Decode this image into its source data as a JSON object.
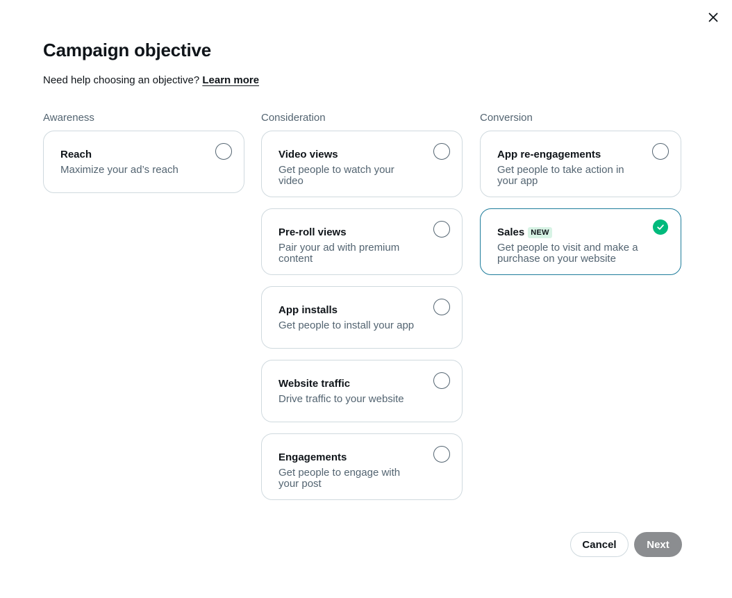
{
  "dialog": {
    "title": "Campaign objective",
    "help_text": "Need help choosing an objective?",
    "help_link": "Learn more",
    "close_icon": "close-icon"
  },
  "columns": [
    {
      "heading": "Awareness",
      "options": [
        {
          "title": "Reach",
          "description": "Maximize your ad’s reach",
          "selected": false
        }
      ]
    },
    {
      "heading": "Consideration",
      "options": [
        {
          "title": "Video views",
          "description": "Get people to watch your video",
          "selected": false
        },
        {
          "title": "Pre-roll views",
          "description": "Pair your ad with premium content",
          "selected": false
        },
        {
          "title": "App installs",
          "description": "Get people to install your app",
          "selected": false
        },
        {
          "title": "Website traffic",
          "description": "Drive traffic to your website",
          "selected": false
        },
        {
          "title": "Engagements",
          "description": "Get people to engage with your post",
          "selected": false
        }
      ]
    },
    {
      "heading": "Conversion",
      "options": [
        {
          "title": "App re-engagements",
          "description": "Get people to take action in your app",
          "selected": false
        },
        {
          "title": "Sales",
          "badge": "NEW",
          "description": "Get people to visit and make a purchase on your website",
          "selected": true
        }
      ]
    }
  ],
  "footer": {
    "cancel_label": "Cancel",
    "next_label": "Next"
  },
  "colors": {
    "selected_border": "#1d7c9b",
    "check_fill": "#00ba7c",
    "badge_bg": "#d8f3e5",
    "next_disabled_bg": "#8b8d90"
  }
}
